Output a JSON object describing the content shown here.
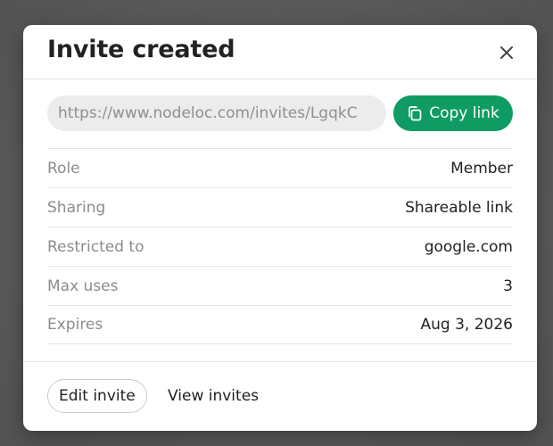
{
  "modal": {
    "title": "Invite created",
    "close_icon": "close-icon"
  },
  "invite_link": {
    "value": "https://www.nodeloc.com/invites/LgqkC",
    "copy_label": "Copy link",
    "copy_icon": "copy-icon"
  },
  "details": [
    {
      "label": "Role",
      "value": "Member"
    },
    {
      "label": "Sharing",
      "value": "Shareable link"
    },
    {
      "label": "Restricted to",
      "value": "google.com"
    },
    {
      "label": "Max uses",
      "value": "3"
    },
    {
      "label": "Expires",
      "value": "Aug 3, 2026"
    }
  ],
  "footer": {
    "edit_label": "Edit invite",
    "view_label": "View invites"
  },
  "colors": {
    "accent": "#0e9c63",
    "backdrop": "#5b5c5b"
  }
}
